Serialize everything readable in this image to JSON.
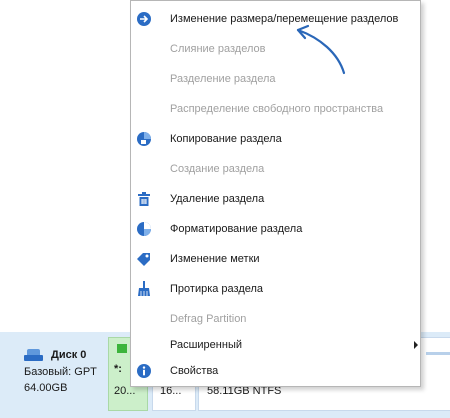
{
  "disk": {
    "name": "Диск 0",
    "type": "Базовый: GPT",
    "size": "64.00GB"
  },
  "partitions": [
    {
      "label": "*:",
      "size": "20..."
    },
    {
      "label": "",
      "size": "16..."
    },
    {
      "label": "",
      "size": "58.11GB NTFS"
    }
  ],
  "menu": {
    "items": [
      {
        "label": "Изменение размера/перемещение разделов",
        "icon": "resize-move-icon",
        "enabled": true
      },
      {
        "label": "Слияние разделов",
        "icon": "",
        "enabled": false
      },
      {
        "label": "Разделение раздела",
        "icon": "",
        "enabled": false
      },
      {
        "label": "Распределение свободного пространства",
        "icon": "",
        "enabled": false
      },
      {
        "label": "Копирование раздела",
        "icon": "copy-partition-icon",
        "enabled": true
      },
      {
        "label": "Создание раздела",
        "icon": "",
        "enabled": false
      },
      {
        "label": "Удаление раздела",
        "icon": "trash-icon",
        "enabled": true
      },
      {
        "label": "Форматирование раздела",
        "icon": "format-icon",
        "enabled": true
      },
      {
        "label": "Изменение метки",
        "icon": "tag-icon",
        "enabled": true
      },
      {
        "label": "Протирка раздела",
        "icon": "broom-icon",
        "enabled": true
      },
      {
        "label": "Defrag Partition",
        "icon": "",
        "enabled": false
      },
      {
        "label": "Расширенный",
        "icon": "",
        "enabled": true,
        "submenu": true
      },
      {
        "label": "Свойства",
        "icon": "info-icon",
        "enabled": true
      }
    ]
  },
  "colors": {
    "accent": "#2b6cc4",
    "disabled_text": "#a0a0a0",
    "annotation_arrow": "#2a67b8",
    "disk_panel_bg": "#dcebf8",
    "partition_green": "#ccefca"
  }
}
